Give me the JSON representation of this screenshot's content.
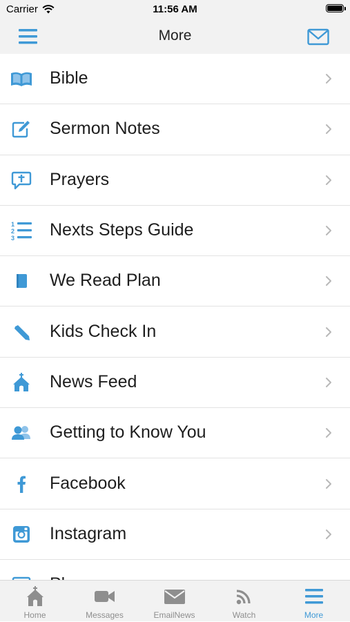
{
  "status_bar": {
    "carrier": "Carrier",
    "time": "11:56 AM"
  },
  "nav": {
    "title": "More",
    "left_icon": "hamburger-menu-icon",
    "right_icon": "envelope-icon"
  },
  "colors": {
    "accent": "#3f99d6",
    "inactive": "#8e8e8e",
    "bar_bg": "#f2f2f2",
    "divider": "#e2e2e2"
  },
  "menu_items": [
    {
      "label": "Bible",
      "icon": "book-icon"
    },
    {
      "label": "Sermon Notes",
      "icon": "edit-notes-icon"
    },
    {
      "label": "Prayers",
      "icon": "prayer-bubble-icon"
    },
    {
      "label": "Nexts Steps Guide",
      "icon": "numbered-list-icon"
    },
    {
      "label": "We Read Plan",
      "icon": "notebook-icon"
    },
    {
      "label": "Kids Check In",
      "icon": "pencil-icon"
    },
    {
      "label": "News Feed",
      "icon": "church-icon"
    },
    {
      "label": "Getting to Know You",
      "icon": "people-icon"
    },
    {
      "label": "Facebook",
      "icon": "facebook-icon"
    },
    {
      "label": "Instagram",
      "icon": "instagram-icon"
    },
    {
      "label": "Pl",
      "icon": "image-icon"
    }
  ],
  "tabs": [
    {
      "label": "Home",
      "icon": "home-icon"
    },
    {
      "label": "Messages",
      "icon": "video-camera-icon"
    },
    {
      "label": "EmailNews",
      "icon": "envelope-icon"
    },
    {
      "label": "Watch",
      "icon": "rss-feed-icon"
    },
    {
      "label": "More",
      "icon": "hamburger-menu-icon",
      "active": true
    }
  ]
}
